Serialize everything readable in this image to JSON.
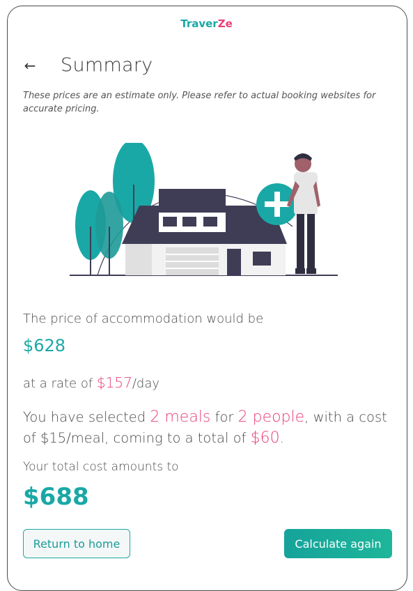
{
  "app": {
    "brand_part1": "Traver",
    "brand_part2": "Ze"
  },
  "header": {
    "title": "Summary",
    "back_icon": "arrow-left-icon"
  },
  "disclaimer": "These prices are an estimate only. Please refer to actual booking websites for accurate pricing.",
  "accommodation": {
    "intro": "The price of accommodation would be",
    "price": "$628",
    "rate_prefix": "at a rate of ",
    "rate_value": "$157",
    "rate_suffix": "/day"
  },
  "meals": {
    "prefix": "You have selected ",
    "meals": "2 meals",
    "for": " for ",
    "people": "2 people",
    "middle": ", with a cost of $15/meal, coming to a total of ",
    "total": "$60",
    "end": "."
  },
  "total": {
    "label": "Your total cost amounts to",
    "value": "$688"
  },
  "buttons": {
    "home": "Return to home",
    "calculate": "Calculate again"
  },
  "colors": {
    "accent": "#1aa8a6",
    "pink": "#e8407a",
    "house_dark": "#3f3d56"
  }
}
